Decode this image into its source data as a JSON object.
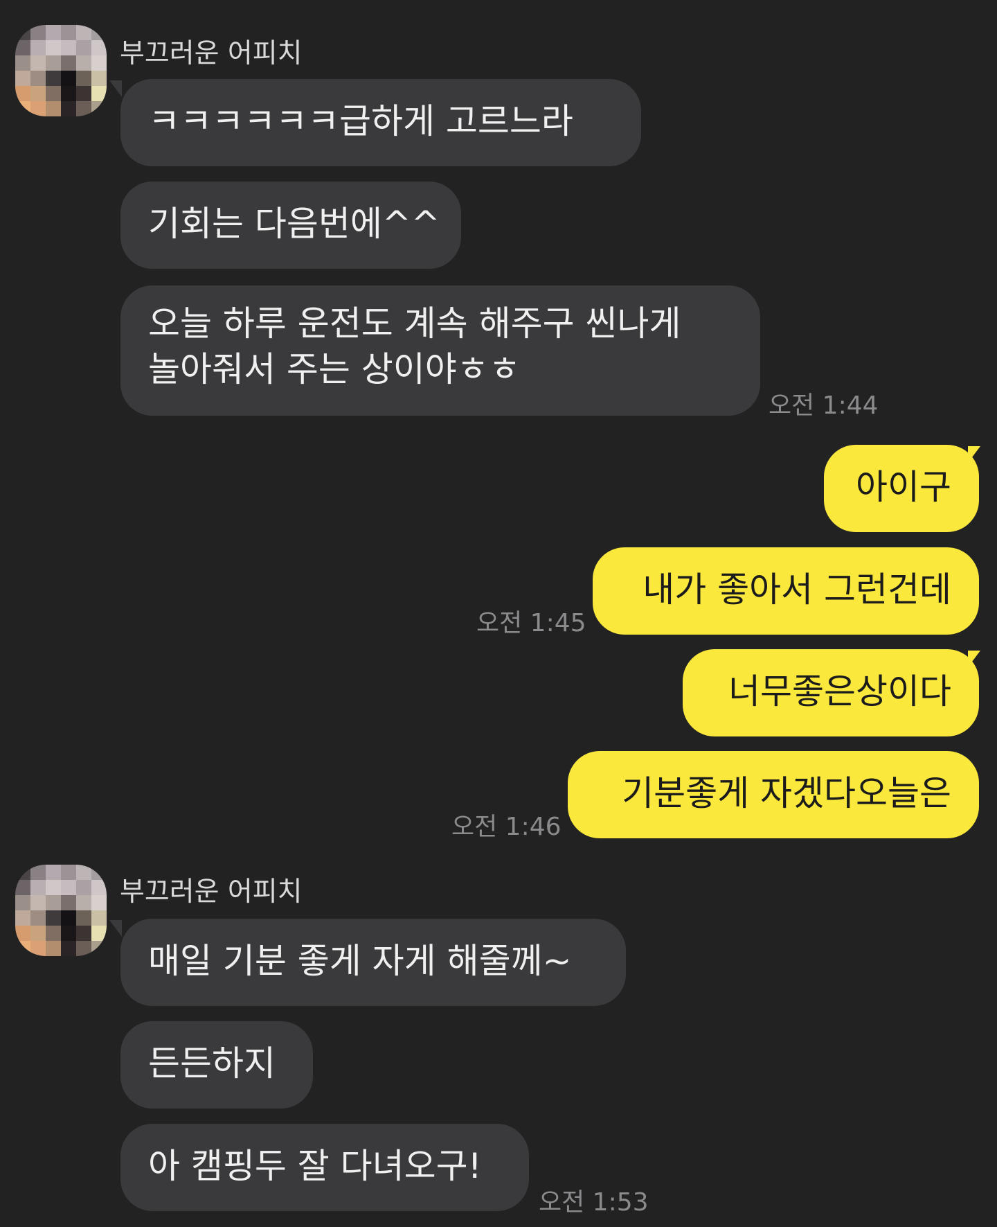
{
  "chat": {
    "colors": {
      "background": "#222223",
      "incoming_bubble": "#3a3a3c",
      "outgoing_bubble": "#fbe83c",
      "timestamp": "#8b8b8d"
    },
    "group1": {
      "sender": "부끄러운 어피치",
      "avatar_icon": "pixelated-profile-avatar",
      "messages": [
        {
          "text": "ㅋㅋㅋㅋㅋㅋ급하게 고르느라"
        },
        {
          "text": "기회는 다음번에^^"
        },
        {
          "line1": "오늘 하루 운전도 계속 해주구 씬나게",
          "line2": "놀아줘서 주는 상이야ㅎㅎ"
        }
      ],
      "time": "오전 1:44"
    },
    "group2": {
      "messages": [
        {
          "text": "아이구"
        },
        {
          "text": "내가 좋아서 그런건데"
        }
      ],
      "time": "오전 1:45"
    },
    "group3": {
      "messages": [
        {
          "text": "너무좋은상이다"
        },
        {
          "text": "기분좋게 자겠다오늘은"
        }
      ],
      "time": "오전 1:46"
    },
    "group4": {
      "sender": "부끄러운 어피치",
      "avatar_icon": "pixelated-profile-avatar",
      "messages": [
        {
          "text": "매일 기분 좋게 자게 해줄께~"
        },
        {
          "text": "든든하지"
        },
        {
          "text": "아 캠핑두 잘 다녀오구!"
        }
      ],
      "time": "오전 1:53"
    }
  }
}
